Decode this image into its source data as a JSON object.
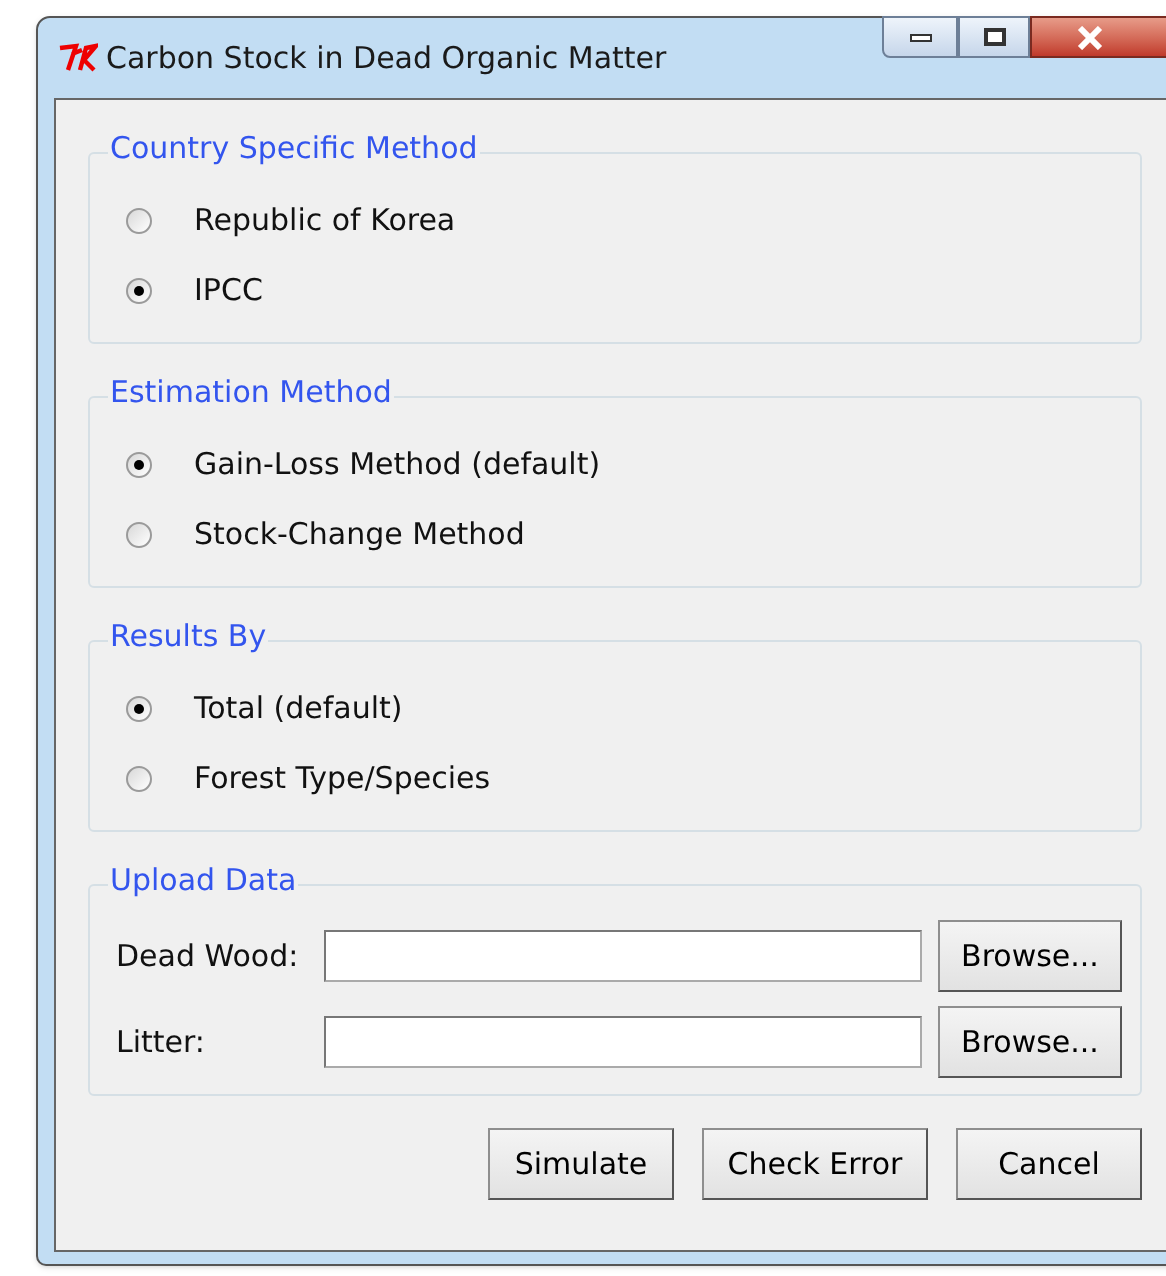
{
  "window": {
    "title": "Carbon Stock in Dead Organic Matter"
  },
  "groups": [
    {
      "title": "Country Specific Method",
      "options": [
        {
          "label": "Republic of Korea",
          "selected": false
        },
        {
          "label": "IPCC",
          "selected": true
        }
      ]
    },
    {
      "title": "Estimation Method",
      "options": [
        {
          "label": "Gain-Loss Method (default)",
          "selected": true
        },
        {
          "label": "Stock-Change Method",
          "selected": false
        }
      ]
    },
    {
      "title": "Results By",
      "options": [
        {
          "label": "Total (default)",
          "selected": true
        },
        {
          "label": "Forest Type/Species",
          "selected": false
        }
      ]
    }
  ],
  "upload": {
    "title": "Upload Data",
    "fields": [
      {
        "label": "Dead Wood:",
        "button": "Browse..."
      },
      {
        "label": "Litter:",
        "button": "Browse..."
      }
    ]
  },
  "buttons": [
    "Simulate",
    "Check Error",
    "Cancel"
  ]
}
